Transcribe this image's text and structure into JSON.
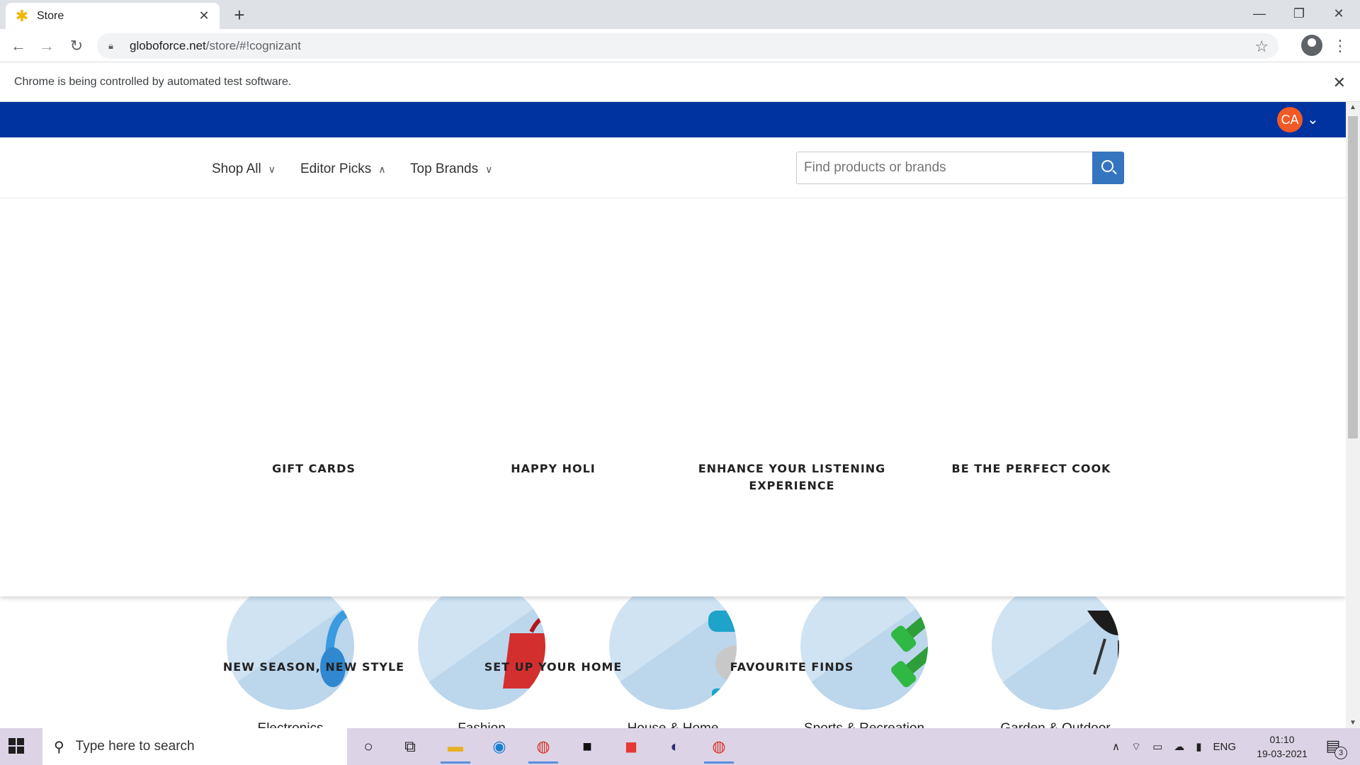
{
  "browser": {
    "tab_title": "Store",
    "tab_favicon": "sparkle-icon",
    "url_host": "globoforce.net",
    "url_path": "/store/#!cognizant",
    "infobar_text": "Chrome is being controlled by automated test software."
  },
  "header": {
    "avatar_initials": "CA",
    "brand_color": "#0033a0",
    "avatar_color": "#f15a24"
  },
  "nav": {
    "items": [
      {
        "label": "Shop All",
        "chevron": "chevron-down-icon"
      },
      {
        "label": "Editor Picks",
        "chevron": "chevron-up-icon"
      },
      {
        "label": "Top Brands",
        "chevron": "chevron-down-icon"
      }
    ],
    "search_placeholder": "Find products or brands"
  },
  "editor_picks": [
    "GIFT CARDS",
    "HAPPY HOLI",
    "ENHANCE YOUR LISTENING EXPERIENCE",
    "BE THE PERFECT COOK",
    "NEW SEASON, NEW STYLE",
    "SET UP YOUR HOME",
    "FAVOURITE FINDS"
  ],
  "categories": [
    {
      "label": "Electronics",
      "icon": "headphones-icon"
    },
    {
      "label": "Fashion",
      "icon": "handbag-icon"
    },
    {
      "label": "House & Home",
      "icon": "stand-mixer-icon"
    },
    {
      "label": "Sports & Recreation",
      "icon": "dumbbells-icon"
    },
    {
      "label": "Garden & Outdoor",
      "icon": "grill-icon"
    }
  ],
  "taskbar": {
    "search_placeholder": "Type here to search",
    "language": "ENG",
    "time": "01:10",
    "date": "19-03-2021",
    "notification_count": "3"
  }
}
